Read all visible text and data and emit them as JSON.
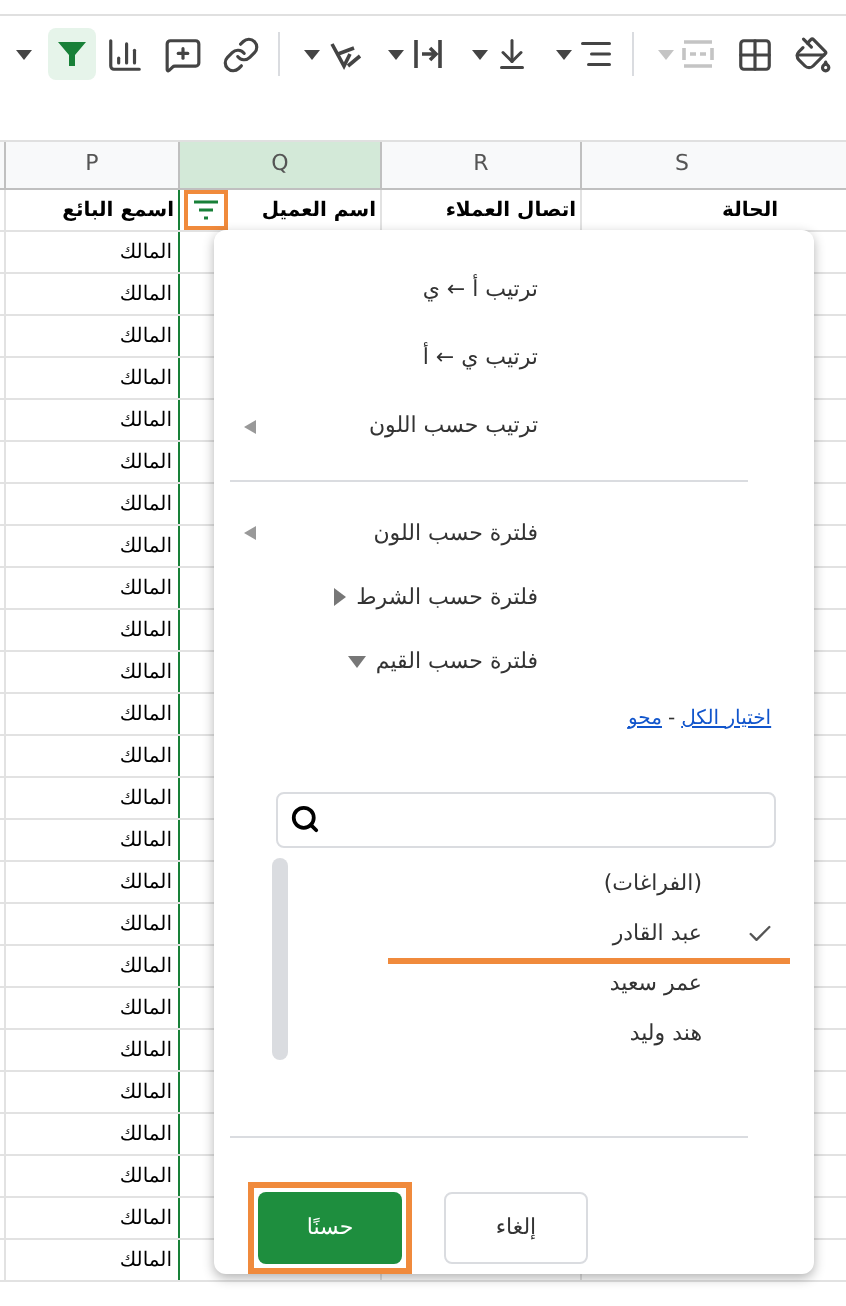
{
  "toolbar_groups": [
    [
      {
        "kind": "caret",
        "has_menu": true,
        "selected": false,
        "disabled": false
      },
      {
        "kind": "filter",
        "has_menu": false,
        "selected": true,
        "disabled": false
      },
      {
        "kind": "chart",
        "has_menu": false,
        "selected": false,
        "disabled": false
      },
      {
        "kind": "comment",
        "has_menu": false,
        "selected": false,
        "disabled": false
      },
      {
        "kind": "link",
        "has_menu": false,
        "selected": false,
        "disabled": false
      }
    ],
    [
      {
        "kind": "rotate",
        "has_menu": true,
        "selected": false,
        "disabled": false
      },
      {
        "kind": "wrap",
        "has_menu": true,
        "selected": false,
        "disabled": false
      },
      {
        "kind": "valign",
        "has_menu": true,
        "selected": false,
        "disabled": false
      },
      {
        "kind": "halign",
        "has_menu": true,
        "selected": false,
        "disabled": false
      }
    ],
    [
      {
        "kind": "merge",
        "has_menu": true,
        "selected": false,
        "disabled": true
      },
      {
        "kind": "borders",
        "has_menu": false,
        "selected": false,
        "disabled": false
      },
      {
        "kind": "fill",
        "has_menu": false,
        "selected": false,
        "disabled": false
      }
    ]
  ],
  "columns": [
    {
      "letter": "S",
      "selected": false
    },
    {
      "letter": "R",
      "selected": false
    },
    {
      "letter": "Q",
      "selected": true
    },
    {
      "letter": "P",
      "selected": false
    }
  ],
  "header_row": [
    {
      "text": "الحالة",
      "filter_button": false,
      "highlighted": false
    },
    {
      "text": "اتصال العملاء",
      "filter_button": false,
      "highlighted": false
    },
    {
      "text": "اسم العميل",
      "filter_button": true,
      "highlighted": true
    },
    {
      "text": "اسمع البائع",
      "filter_button": false,
      "highlighted": false
    }
  ],
  "rows": [
    "المالك",
    "المالك",
    "المالك",
    "المالك",
    "المالك",
    "المالك",
    "المالك",
    "المالك",
    "المالك",
    "المالك",
    "المالك",
    "المالك",
    "المالك",
    "المالك",
    "المالك",
    "المالك",
    "المالك",
    "المالك",
    "المالك",
    "المالك",
    "المالك",
    "المالك",
    "المالك",
    "المالك",
    "المالك"
  ],
  "filter_menu": {
    "sort_items": [
      {
        "label": "ترتيب أ ← ي",
        "kind": "plain"
      },
      {
        "label": "ترتيب ي ← أ",
        "kind": "plain"
      },
      {
        "label": "ترتيب حسب اللون",
        "kind": "submenu"
      }
    ],
    "filter_items": [
      {
        "label": "فلترة حسب اللون",
        "kind": "submenu"
      },
      {
        "label": "فلترة حسب الشرط",
        "kind": "section",
        "expanded": false
      },
      {
        "label": "فلترة حسب القيم",
        "kind": "section",
        "expanded": true
      }
    ],
    "select_all": "اختيار الكل",
    "link_separator": "-",
    "clear": "محو",
    "values": [
      {
        "label": "(الفراغات)",
        "checked": false,
        "highlighted": false
      },
      {
        "label": "عبد القادر",
        "checked": true,
        "highlighted": true
      },
      {
        "label": "عمر سعيد",
        "checked": false,
        "highlighted": false
      },
      {
        "label": "هند وليد",
        "checked": false,
        "highlighted": false
      }
    ],
    "buttons": [
      {
        "label": "إلغاء",
        "kind": "secondary",
        "highlighted": false
      },
      {
        "label": "حسنًا",
        "kind": "primary",
        "highlighted": true
      }
    ]
  }
}
